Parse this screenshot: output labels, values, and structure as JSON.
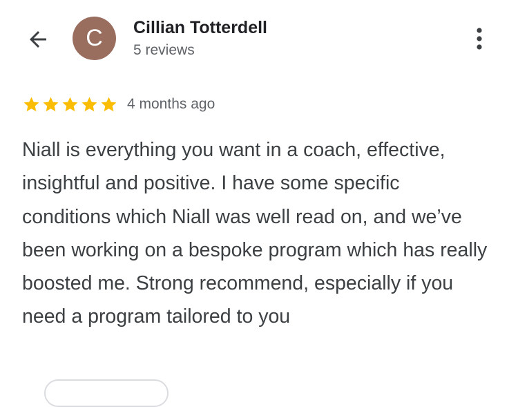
{
  "reviewer": {
    "initial": "C",
    "name": "Cillian Totterdell",
    "review_count": "5 reviews",
    "avatar_color": "#9a6e5f"
  },
  "review": {
    "rating": 5,
    "date": "4 months ago",
    "text": "Niall is everything you want in a coach, effective, insightful and positive. I have some specific conditions which Niall was well read on, and we’ve been working on a bespoke program which has really boosted me. Strong recommend, especially if you need a program tailored to you",
    "star_color": "#fbbc04"
  },
  "icons": {
    "back": "arrow-back-icon",
    "more": "more-vert-icon",
    "star": "star-icon"
  }
}
